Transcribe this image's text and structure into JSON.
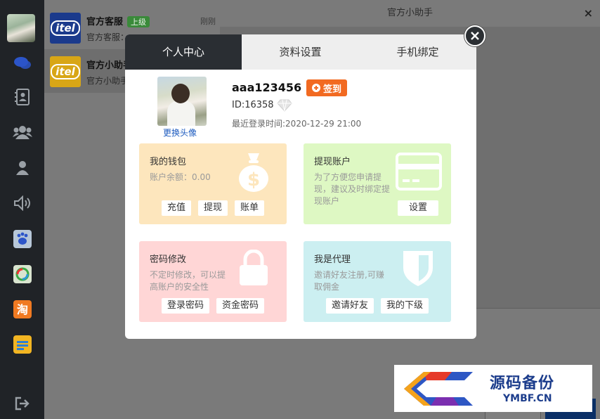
{
  "chat": {
    "title": "官方小助手",
    "close_icon": "×"
  },
  "conversations": [
    {
      "name": "官方客服",
      "badge": "上级",
      "time": "刚刚",
      "preview": "官方客服：",
      "logo_text": "itel",
      "logo_color": "#1b3a8c"
    },
    {
      "name": "官方小助手",
      "badge": "",
      "time": "",
      "preview": "官方小助手",
      "logo_text": "itel",
      "logo_color": "#d8a616"
    }
  ],
  "modal": {
    "tabs": [
      "个人中心",
      "资料设置",
      "手机绑定"
    ],
    "active_tab": 0,
    "profile": {
      "change_avatar": "更换头像",
      "username": "aaa123456",
      "sign_in": "签到",
      "id_label": "ID:16358",
      "last_login": "最近登录时间:2020-12-29 21:00"
    },
    "cards": [
      {
        "title": "我的钱包",
        "desc": "账户余额：0.00",
        "icon": "money-bag-icon",
        "buttons": [
          "充值",
          "提现",
          "账单"
        ],
        "color": "#fde6bd"
      },
      {
        "title": "提现账户",
        "desc": "为了方便您申请提现，建议及时绑定提现账户",
        "icon": "bank-card-icon",
        "buttons": [
          "设置"
        ],
        "color": "#def8c3"
      },
      {
        "title": "密码修改",
        "desc": "不定时修改，可以提高账户的安全性",
        "icon": "lock-icon",
        "buttons": [
          "登录密码",
          "资金密码"
        ],
        "color": "#ffd6d6"
      },
      {
        "title": "我是代理",
        "desc": "邀请好友注册,可赚取佣金",
        "icon": "shield-icon",
        "buttons": [
          "邀请好友",
          "我的下级"
        ],
        "color": "#cceff1"
      }
    ]
  },
  "watermark": {
    "glyph": "码",
    "title": "源码备份",
    "domain": "YMBF.CN"
  },
  "colors": {
    "sidebar": "#202327",
    "tab_active": "#2a2e33",
    "sign_button": "#f26a21",
    "link": "#1d5bbf"
  }
}
